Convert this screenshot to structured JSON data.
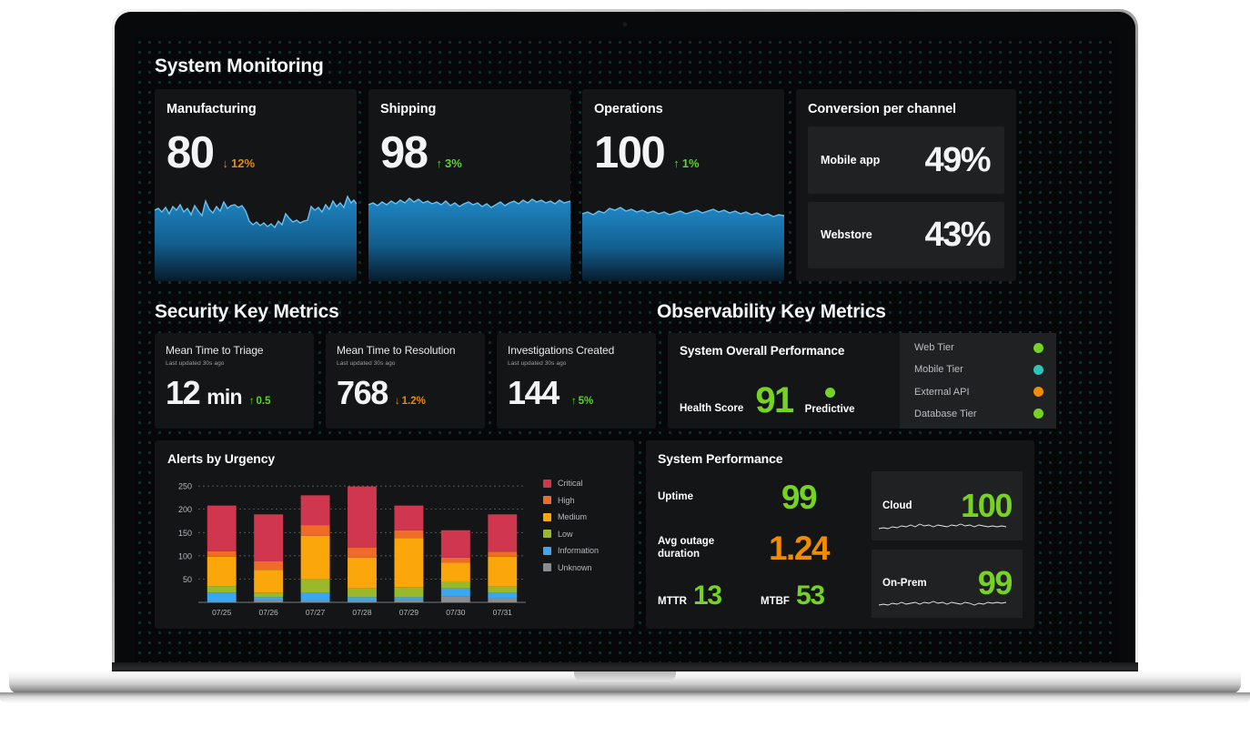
{
  "sections": {
    "system_monitoring_title": "System Monitoring",
    "security_title": "Security Key Metrics",
    "observability_title": "Observability Key Metrics"
  },
  "kpis": [
    {
      "title": "Manufacturing",
      "value": "80",
      "delta": "12%",
      "direction": "down",
      "arrow": "↓"
    },
    {
      "title": "Shipping",
      "value": "98",
      "delta": "3%",
      "direction": "up",
      "arrow": "↑"
    },
    {
      "title": "Operations",
      "value": "100",
      "delta": "1%",
      "direction": "up",
      "arrow": "↑"
    }
  ],
  "conversion": {
    "title": "Conversion per channel",
    "rows": [
      {
        "label": "Mobile app",
        "value": "49%"
      },
      {
        "label": "Webstore",
        "value": "43%"
      }
    ]
  },
  "security_metrics": [
    {
      "title": "Mean Time to Triage",
      "subtitle": "Last updated 30s ago",
      "value": "12",
      "unit": "min",
      "delta": "0.5",
      "direction": "up",
      "arrow": "↑"
    },
    {
      "title": "Mean Time to Resolution",
      "subtitle": "Last updated 30s ago",
      "value": "768",
      "unit": "",
      "delta": "1.2%",
      "direction": "down",
      "arrow": "↓"
    },
    {
      "title": "Investigations Created",
      "subtitle": "Last updated 30s ago",
      "value": "144",
      "unit": "",
      "delta": "5%",
      "direction": "up",
      "arrow": "↑"
    }
  ],
  "system_overall": {
    "title": "System Overall Performance",
    "health_score_label": "Health Score",
    "health_score": "91",
    "predictive_label": "Predictive",
    "predictive_color": "#76d323",
    "tiers": [
      {
        "name": "Web Tier",
        "color": "#76d323"
      },
      {
        "name": "Mobile Tier",
        "color": "#2ec4b6"
      },
      {
        "name": "External API",
        "color": "#f08c00"
      },
      {
        "name": "Database Tier",
        "color": "#76d323"
      }
    ]
  },
  "system_performance": {
    "title": "System Performance",
    "metrics": [
      {
        "label": "Uptime",
        "value": "99",
        "color": "green"
      },
      {
        "label": "Avg outage duration",
        "value": "1.24",
        "color": "orange"
      }
    ],
    "pairs": [
      {
        "label": "MTTR",
        "value": "13"
      },
      {
        "label": "MTBF",
        "value": "53"
      }
    ],
    "minis": [
      {
        "label": "Cloud",
        "value": "100"
      },
      {
        "label": "On-Prem",
        "value": "99"
      }
    ]
  },
  "chart_data": {
    "type": "bar",
    "title": "Alerts by Urgency",
    "stacked": true,
    "xlabel": "",
    "ylabel": "",
    "ylim": [
      0,
      262
    ],
    "yticks": [
      50,
      100,
      150,
      200,
      250
    ],
    "grid": true,
    "legend_position": "right",
    "categories": [
      "07/25",
      "07/26",
      "07/27",
      "07/28",
      "07/29",
      "07/30",
      "07/31"
    ],
    "series": [
      {
        "name": "Unknown",
        "color": "#8a8d8f",
        "values": [
          2,
          5,
          3,
          3,
          6,
          13,
          9
        ]
      },
      {
        "name": "Information",
        "color": "#3aa7f0",
        "values": [
          19,
          6,
          17,
          8,
          5,
          17,
          11
        ]
      },
      {
        "name": "Low",
        "color": "#9ab829",
        "values": [
          14,
          10,
          30,
          19,
          22,
          15,
          14
        ]
      },
      {
        "name": "Medium",
        "color": "#fba60b",
        "values": [
          63,
          49,
          93,
          66,
          105,
          40,
          64
        ]
      },
      {
        "name": "High",
        "color": "#ef6b28",
        "values": [
          12,
          18,
          23,
          22,
          17,
          11,
          11
        ]
      },
      {
        "name": "Critical",
        "color": "#d0374f",
        "values": [
          98,
          101,
          64,
          131,
          53,
          59,
          80
        ]
      }
    ],
    "totals": [
      208,
      189,
      230,
      249,
      208,
      155,
      189
    ]
  }
}
